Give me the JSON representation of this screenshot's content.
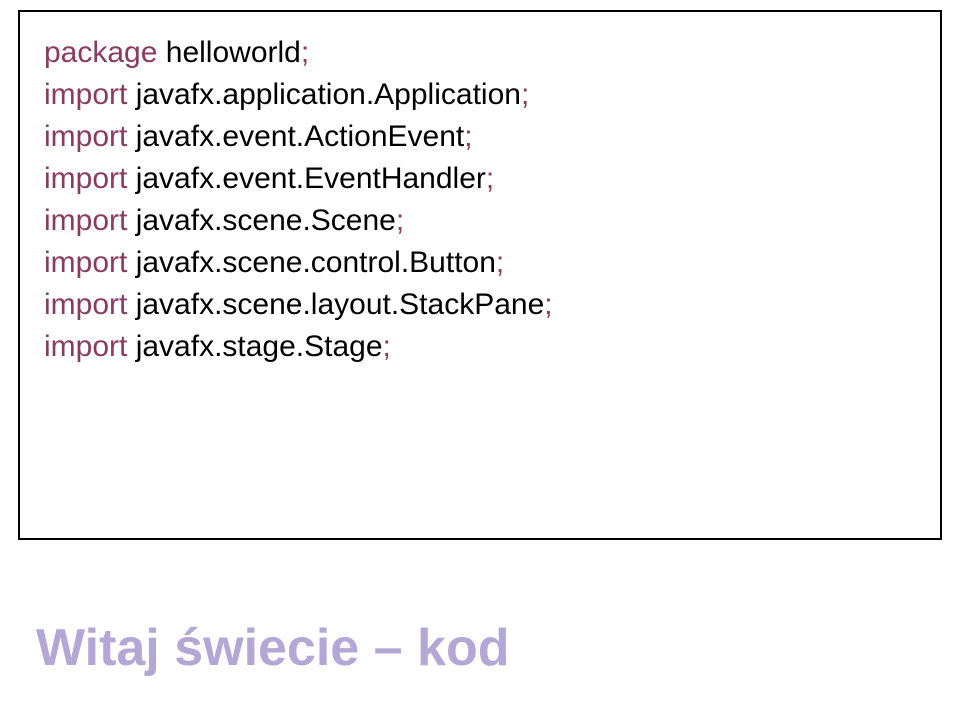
{
  "code": {
    "package_kw": "package",
    "package_name": " helloworld",
    "import_kw": "import",
    "semicolon": ";",
    "blank": "",
    "imports": [
      " javafx.application.Application",
      " javafx.event.ActionEvent",
      " javafx.event.EventHandler",
      " javafx.scene.Scene",
      " javafx.scene.control.Button",
      " javafx.scene.layout.StackPane",
      " javafx.stage.Stage"
    ]
  },
  "title": "Witaj świecie – kod"
}
